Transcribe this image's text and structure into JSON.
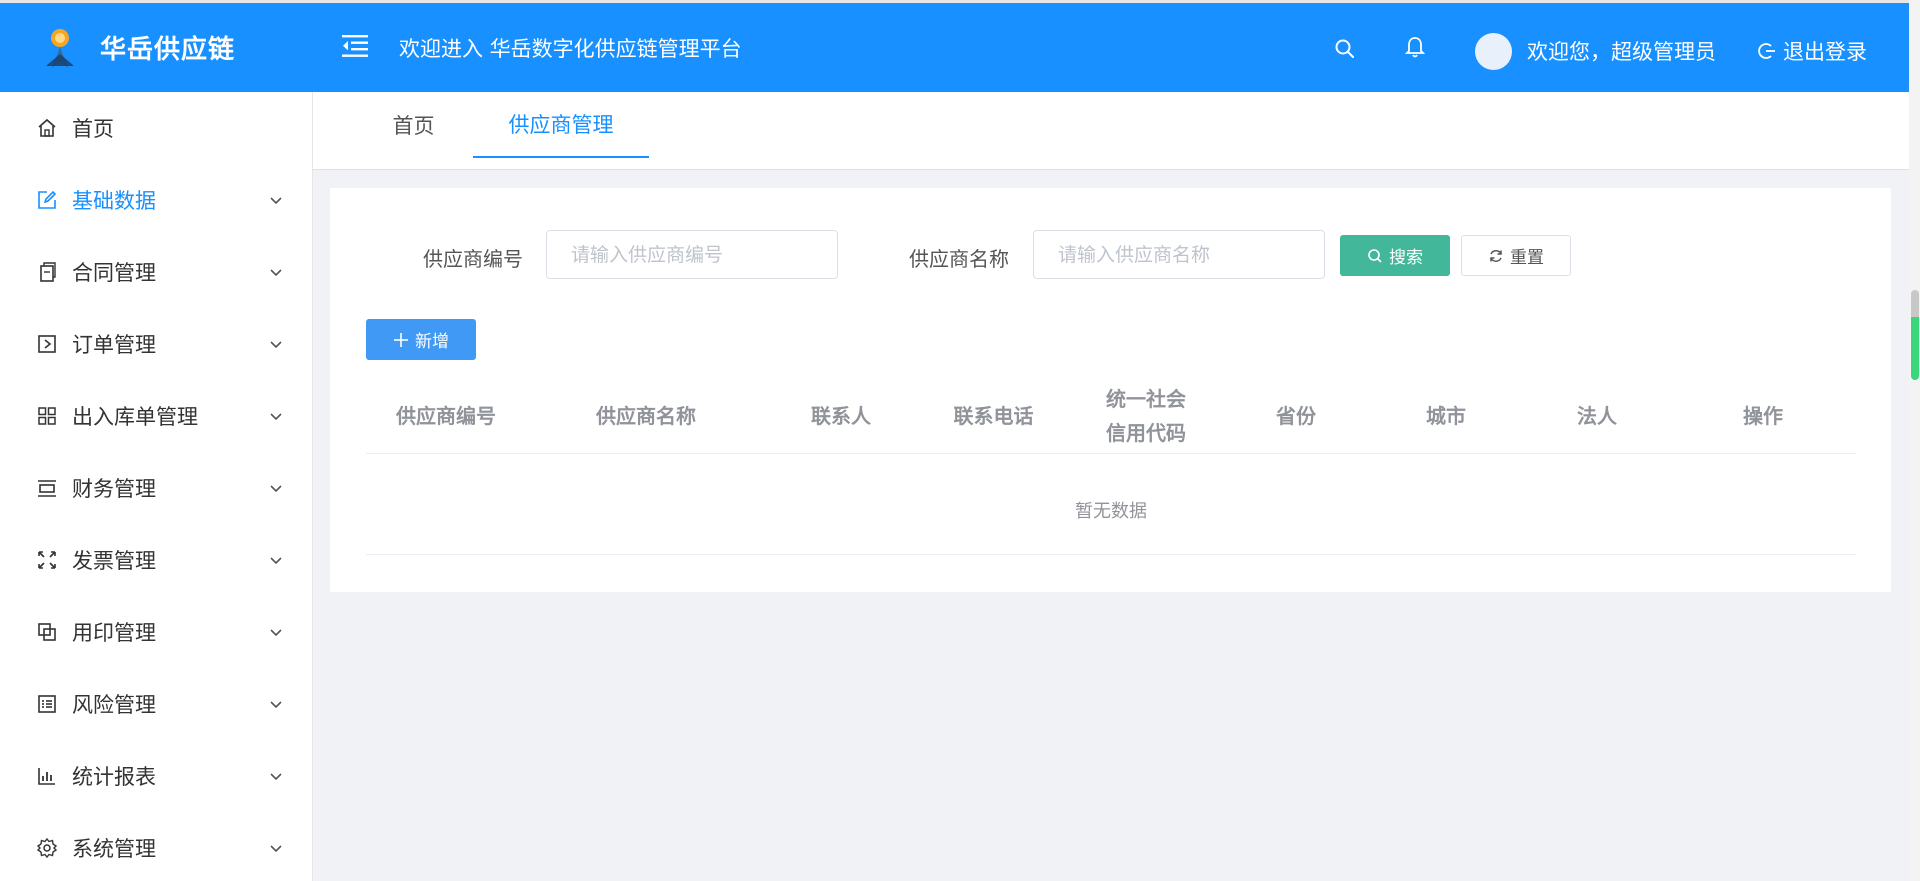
{
  "header": {
    "brand": "华岳供应链",
    "welcome_title": "欢迎进入 华岳数字化供应链管理平台",
    "greeting": "欢迎您，超级管理员",
    "logout_label": "退出登录",
    "background_color": "#1890ff"
  },
  "sidebar": {
    "items": [
      {
        "label": "首页",
        "icon": "home-icon",
        "has_children": false
      },
      {
        "label": "基础数据",
        "icon": "edit-icon",
        "has_children": true,
        "active": true
      },
      {
        "label": "合同管理",
        "icon": "document-icon",
        "has_children": true
      },
      {
        "label": "订单管理",
        "icon": "play-square-icon",
        "has_children": true
      },
      {
        "label": "出入库单管理",
        "icon": "grid-icon",
        "has_children": true
      },
      {
        "label": "财务管理",
        "icon": "ruler-icon",
        "has_children": true
      },
      {
        "label": "发票管理",
        "icon": "expand-icon",
        "has_children": true
      },
      {
        "label": "用印管理",
        "icon": "copy-icon",
        "has_children": true
      },
      {
        "label": "风险管理",
        "icon": "list-icon",
        "has_children": true
      },
      {
        "label": "统计报表",
        "icon": "bar-chart-icon",
        "has_children": true
      },
      {
        "label": "系统管理",
        "icon": "gear-icon",
        "has_children": true
      }
    ]
  },
  "tabs": [
    {
      "label": "首页"
    },
    {
      "label": "供应商管理",
      "active": true
    }
  ],
  "search_form": {
    "supplier_code_label": "供应商编号",
    "supplier_code_placeholder": "请输入供应商编号",
    "supplier_code_value": "",
    "supplier_name_label": "供应商名称",
    "supplier_name_placeholder": "请输入供应商名称",
    "supplier_name_value": "",
    "search_label": "搜索",
    "reset_label": "重置",
    "search_color": "#42b799"
  },
  "toolbar": {
    "add_label": "新增"
  },
  "table": {
    "columns": [
      "供应商编号",
      "供应商名称",
      "联系人",
      "联系电话",
      "统一社会信用代码",
      "省份",
      "城市",
      "法人",
      "操作"
    ],
    "rows": [],
    "empty_text": "暂无数据"
  }
}
